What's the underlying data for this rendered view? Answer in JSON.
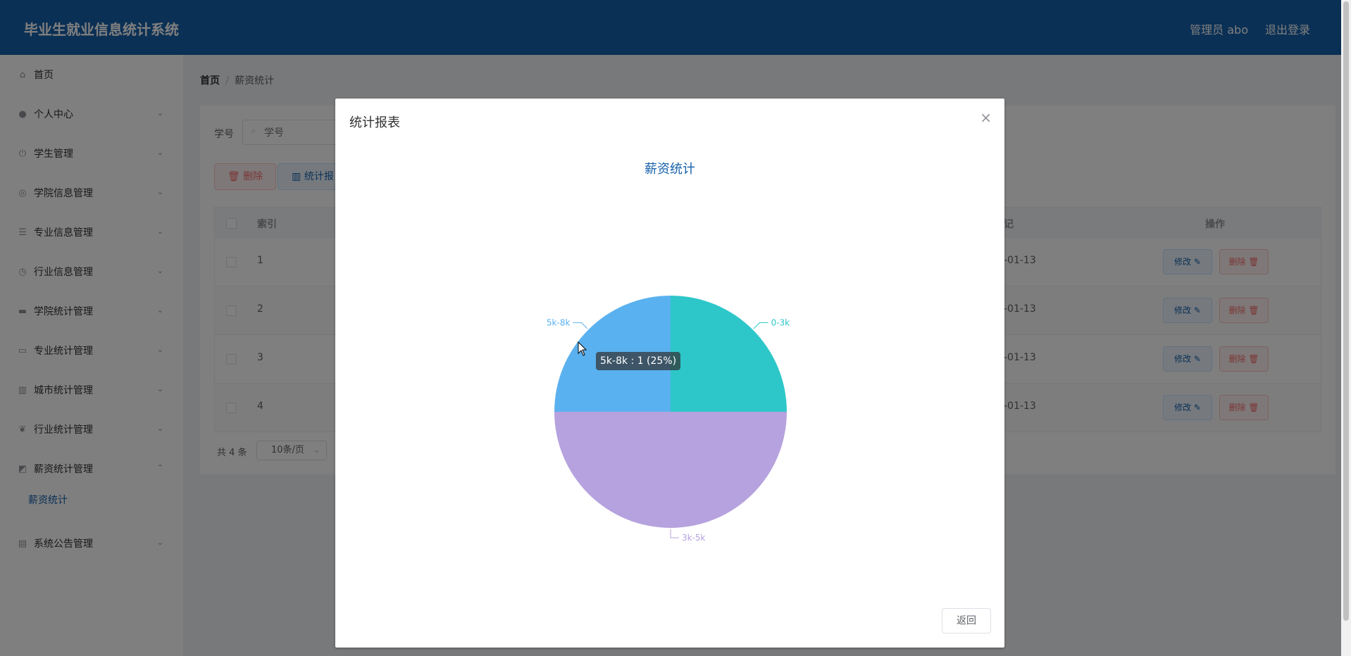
{
  "header": {
    "title": "毕业生就业信息统计系统",
    "user": "管理员 abo",
    "logout": "退出登录"
  },
  "sidebar": {
    "items": [
      {
        "label": "首页",
        "icon": "home-icon"
      },
      {
        "label": "个人中心",
        "icon": "user-icon"
      },
      {
        "label": "学生管理",
        "icon": "power-icon"
      },
      {
        "label": "学院信息管理",
        "icon": "compass-icon"
      },
      {
        "label": "专业信息管理",
        "icon": "sliders-icon"
      },
      {
        "label": "行业信息管理",
        "icon": "clock-icon"
      },
      {
        "label": "学院统计管理",
        "icon": "briefcase-icon"
      },
      {
        "label": "专业统计管理",
        "icon": "monitor-icon"
      },
      {
        "label": "城市统计管理",
        "icon": "bar-chart-icon"
      },
      {
        "label": "行业统计管理",
        "icon": "leaf-icon"
      },
      {
        "label": "薪资统计管理",
        "icon": "line-chart-icon"
      },
      {
        "label": "系统公告管理",
        "icon": "clipboard-icon"
      }
    ],
    "submenu_active": "薪资统计"
  },
  "breadcrumb": {
    "home": "首页",
    "separator": "/",
    "current": "薪资统计"
  },
  "search": {
    "label": "学号",
    "placeholder": "学号"
  },
  "toolbar": {
    "delete": "删除",
    "stat": "统计报"
  },
  "table": {
    "headers": {
      "index": "索引",
      "date_partial": "记",
      "action": "操作"
    },
    "rows": [
      {
        "index": "1",
        "date": "-01-13"
      },
      {
        "index": "2",
        "date": "-01-13"
      },
      {
        "index": "3",
        "date": "-01-13"
      },
      {
        "index": "4",
        "date": "-01-13"
      }
    ],
    "edit_label": "修改",
    "delete_label": "删除"
  },
  "pagination": {
    "total": "共 4 条",
    "page_size": "10条/页"
  },
  "dialog": {
    "title": "统计报表",
    "close": "×",
    "return": "返回"
  },
  "tooltip": "5k-8k : 1 (25%)",
  "chart_data": {
    "type": "pie",
    "title": "薪资统计",
    "slices": [
      {
        "label": "0-3k",
        "value": 1,
        "color": "#2ec7c9"
      },
      {
        "label": "3k-5k",
        "value": 2,
        "color": "#b6a2de"
      },
      {
        "label": "5k-8k",
        "value": 1,
        "color": "#5ab1ef"
      }
    ]
  }
}
